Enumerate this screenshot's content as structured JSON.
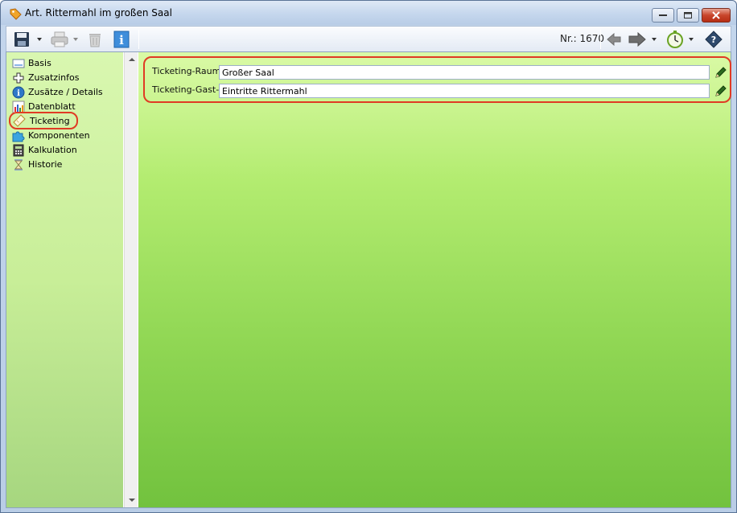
{
  "window": {
    "title": "Art. Rittermahl im großen Saal"
  },
  "toolbar": {
    "record_number": "Nr.: 1670",
    "icons": [
      "save-icon",
      "print-icon",
      "trash-icon",
      "info-icon",
      "back-arrow-icon",
      "forward-arrow-icon",
      "timer-icon",
      "help-book-icon"
    ]
  },
  "sidebar": {
    "items": [
      {
        "label": "Basis",
        "icon": "form-icon"
      },
      {
        "label": "Zusatzinfos",
        "icon": "plus-icon"
      },
      {
        "label": "Zusätze / Details",
        "icon": "info-circle-icon"
      },
      {
        "label": "Datenblatt",
        "icon": "chart-icon"
      },
      {
        "label": "Ticketing",
        "icon": "ticket-icon"
      },
      {
        "label": "Komponenten",
        "icon": "puzzle-icon"
      },
      {
        "label": "Kalkulation",
        "icon": "calculator-icon"
      },
      {
        "label": "Historie",
        "icon": "hourglass-icon"
      }
    ],
    "selected": "Ticketing"
  },
  "ticketing": {
    "raum_label": "Ticketing-Raum:",
    "raum_value": "Großer Saal",
    "gast_art_label": "Ticketing-Gast-Art",
    "gast_art_value": "Eintritte Rittermahl"
  },
  "colors": {
    "highlight_ring": "#e03b24",
    "sidebar_green": "#c8ee98",
    "main_green": "#8fd653"
  }
}
